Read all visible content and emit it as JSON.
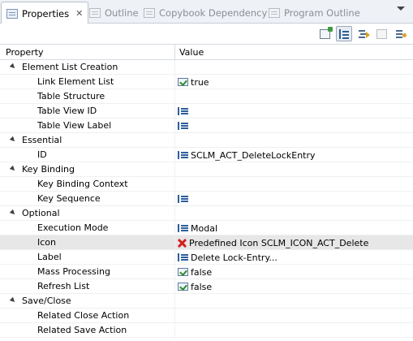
{
  "tabs": [
    {
      "label": "Properties",
      "icon": "properties-icon",
      "active": true,
      "close": "✕"
    },
    {
      "label": "Outline",
      "icon": "outline-icon",
      "active": false
    },
    {
      "label": "Copybook Dependency",
      "icon": "copybook-dependency-icon",
      "active": false
    },
    {
      "label": "Program Outline",
      "icon": "program-outline-icon",
      "active": false
    }
  ],
  "toolbar": {
    "buttons": [
      "pin-to-selection-icon",
      "show-categories-icon",
      "show-advanced-icon",
      "filter-icon",
      "restore-default-icon"
    ]
  },
  "table": {
    "headers": {
      "property": "Property",
      "value": "Value"
    },
    "rows": [
      {
        "type": "category",
        "property": "Element List Creation",
        "value": "",
        "icon": ""
      },
      {
        "type": "leaf",
        "property": "Link Element List",
        "value": "true",
        "icon": "boolean-icon"
      },
      {
        "type": "leaf",
        "property": "Table Structure",
        "value": "",
        "icon": ""
      },
      {
        "type": "leaf",
        "property": "Table View ID",
        "value": "",
        "icon": "list-value-icon"
      },
      {
        "type": "leaf",
        "property": "Table View Label",
        "value": "",
        "icon": "list-value-icon"
      },
      {
        "type": "category",
        "property": "Essential",
        "value": "",
        "icon": ""
      },
      {
        "type": "leaf",
        "property": "ID",
        "value": "SCLM_ACT_DeleteLockEntry",
        "icon": "list-value-icon"
      },
      {
        "type": "category",
        "property": "Key Binding",
        "value": "",
        "icon": ""
      },
      {
        "type": "leaf",
        "property": "Key Binding Context",
        "value": "",
        "icon": ""
      },
      {
        "type": "leaf",
        "property": "Key Sequence",
        "value": "",
        "icon": "list-value-icon"
      },
      {
        "type": "category",
        "property": "Optional",
        "value": "",
        "icon": ""
      },
      {
        "type": "leaf",
        "property": "Execution Mode",
        "value": "Modal",
        "icon": "list-value-icon"
      },
      {
        "type": "leaf",
        "property": "Icon",
        "value": "Predefined Icon SCLM_ICON_ACT_Delete",
        "icon": "error-icon",
        "selected": true
      },
      {
        "type": "leaf",
        "property": "Label",
        "value": "Delete Lock-Entry...",
        "icon": "list-value-icon"
      },
      {
        "type": "leaf",
        "property": "Mass Processing",
        "value": "false",
        "icon": "boolean-icon"
      },
      {
        "type": "leaf",
        "property": "Refresh List",
        "value": "false",
        "icon": "boolean-icon"
      },
      {
        "type": "category",
        "property": "Save/Close",
        "value": "",
        "icon": ""
      },
      {
        "type": "leaf",
        "property": "Related Close Action",
        "value": "",
        "icon": ""
      },
      {
        "type": "leaf",
        "property": "Related Save Action",
        "value": "",
        "icon": ""
      }
    ]
  }
}
